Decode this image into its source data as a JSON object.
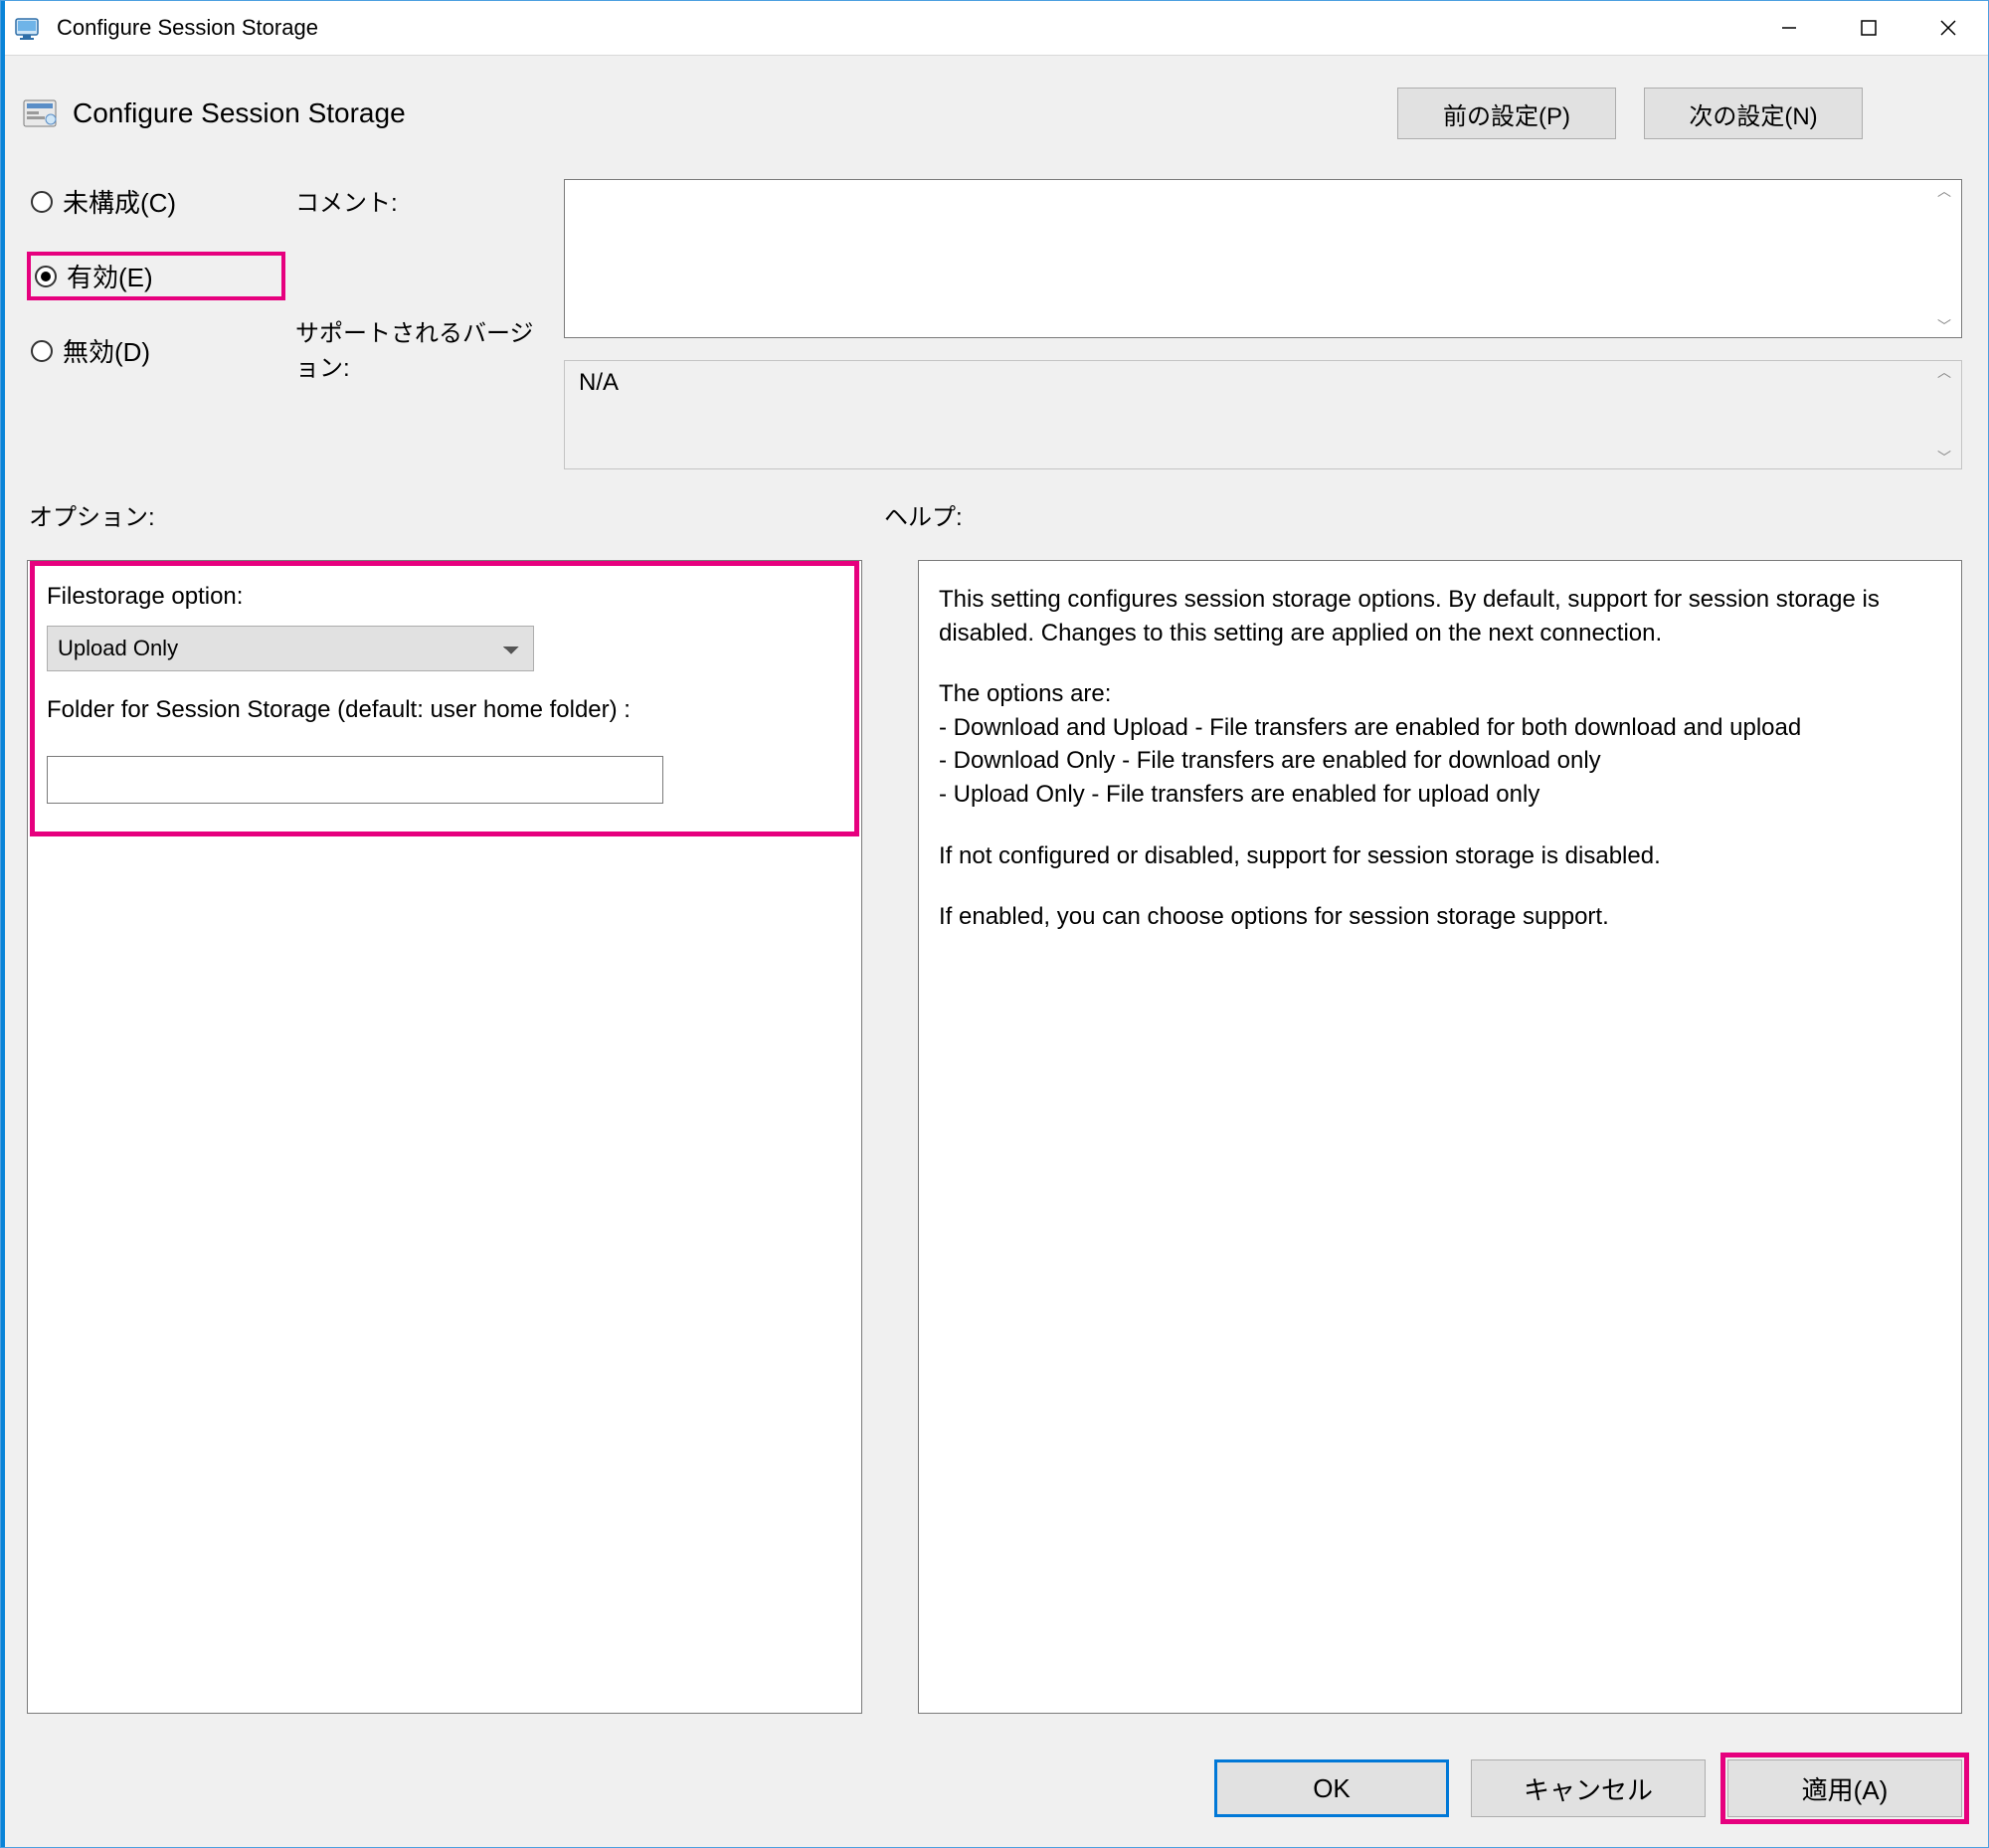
{
  "window": {
    "title": "Configure Session Storage"
  },
  "header": {
    "title": "Configure Session Storage",
    "prev_label": "前の設定(P)",
    "next_label": "次の設定(N)"
  },
  "radios": {
    "not_configured": "未構成(C)",
    "enabled": "有効(E)",
    "disabled": "無効(D)",
    "selected": "enabled"
  },
  "labels": {
    "comment": "コメント:",
    "supported": "サポートされるバージョン:",
    "options": "オプション:",
    "help": "ヘルプ:"
  },
  "fields": {
    "comment_value": "",
    "supported_value": "N/A"
  },
  "options": {
    "filestorage_label": "Filestorage option:",
    "filestorage_value": "Upload Only",
    "folder_label": "Folder for Session Storage (default: user home folder) :",
    "folder_value": ""
  },
  "help": {
    "p1": "This setting configures session storage options. By default, support for session storage is disabled. Changes to this setting are applied on the next connection.",
    "p2a": "The options are:",
    "p2b": "- Download and Upload - File transfers are enabled for both download and upload",
    "p2c": "- Download Only - File transfers are enabled for download only",
    "p2d": "- Upload Only - File transfers are enabled for upload only",
    "p3": "If not configured or disabled, support for session storage is disabled.",
    "p4": "If enabled, you can choose options for session storage support."
  },
  "footer": {
    "ok": "OK",
    "cancel": "キャンセル",
    "apply": "適用(A)"
  }
}
